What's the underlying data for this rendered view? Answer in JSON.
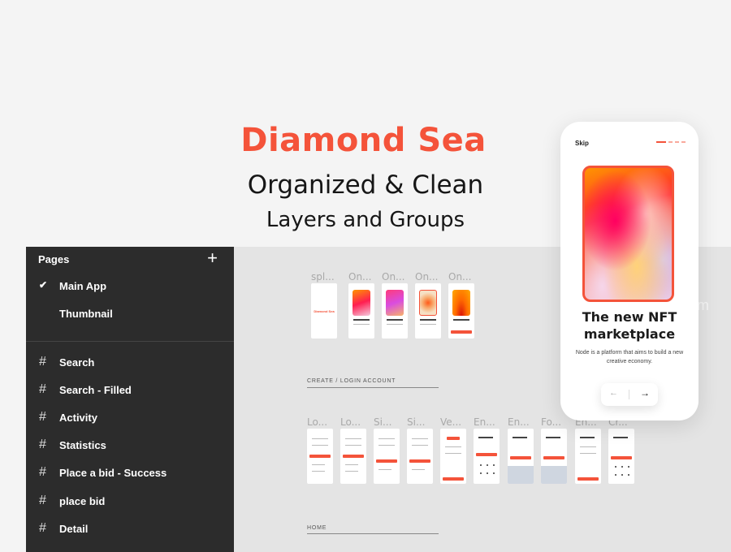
{
  "hero": {
    "title": "Diamond Sea",
    "subtitle": "Organized & Clean",
    "tagline": "Layers and Groups",
    "accent_color": "#f4533a"
  },
  "sidebar": {
    "header": "Pages",
    "add_icon": "plus-icon",
    "pages": [
      {
        "label": "Main App",
        "selected": true
      },
      {
        "label": "Thumbnail",
        "selected": false
      }
    ],
    "frames": [
      {
        "label": "Search"
      },
      {
        "label": "Search - Filled"
      },
      {
        "label": "Activity"
      },
      {
        "label": "Statistics"
      },
      {
        "label": "Place a bid - Success"
      },
      {
        "label": "place bid"
      },
      {
        "label": "Detail"
      }
    ]
  },
  "canvas": {
    "onboarding_frames": [
      "spl...",
      "On...",
      "On...",
      "On...",
      "On..."
    ],
    "splash_text": "Diamond Sea",
    "sections": [
      {
        "label": "CREATE / LOGIN ACCOUNT"
      },
      {
        "label": "HOME"
      }
    ],
    "account_frames": [
      "Lo...",
      "Lo...",
      "Si...",
      "Si...",
      "Ve...",
      "En...",
      "En...",
      "Fo...",
      "En...",
      "Cr..."
    ],
    "watermark": "om"
  },
  "phone": {
    "skip_label": "Skip",
    "title_line1": "The new NFT",
    "title_line2": "marketplace",
    "description": "Node is a platform that aims to build a new creative economy.",
    "prev_icon": "arrow-left-icon",
    "next_icon": "arrow-right-icon",
    "prev_glyph": "←",
    "next_glyph": "→",
    "page_indicator": {
      "current": 1,
      "total": 4
    }
  }
}
